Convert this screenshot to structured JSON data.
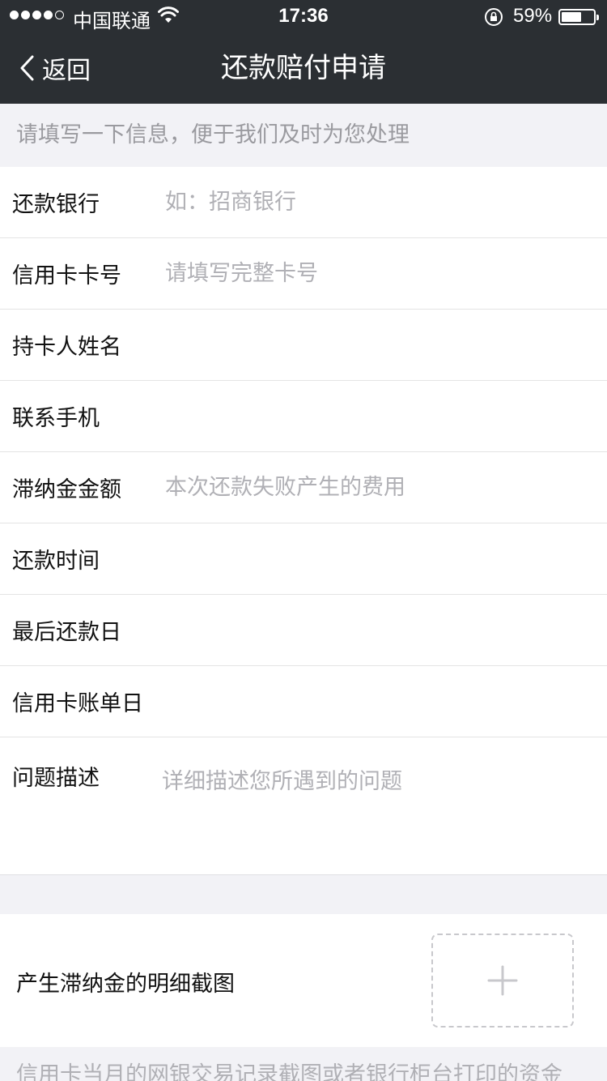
{
  "status_bar": {
    "carrier": "中国联通",
    "time": "17:36",
    "battery": "59%",
    "battery_level": 0.59
  },
  "nav": {
    "back_label": "返回",
    "title": "还款赔付申请"
  },
  "hint": "请填写一下信息，便于我们及时为您处理",
  "form": {
    "rows": [
      {
        "label": "还款银行",
        "placeholder": "如：招商银行"
      },
      {
        "label": "信用卡卡号",
        "placeholder": "请填写完整卡号"
      },
      {
        "label": "持卡人姓名",
        "placeholder": ""
      },
      {
        "label": "联系手机",
        "placeholder": ""
      },
      {
        "label": "滞纳金金额",
        "placeholder": "本次还款失败产生的费用"
      },
      {
        "label": "还款时间",
        "placeholder": ""
      },
      {
        "label": "最后还款日",
        "placeholder": ""
      },
      {
        "label": "信用卡账单日",
        "placeholder": ""
      }
    ],
    "description": {
      "label": "问题描述",
      "placeholder": "详细描述您所遇到的问题"
    }
  },
  "upload": {
    "label": "产生滞纳金的明细截图"
  },
  "note": "信用卡当月的网银交易记录截图或者银行柜台打印的资金"
}
